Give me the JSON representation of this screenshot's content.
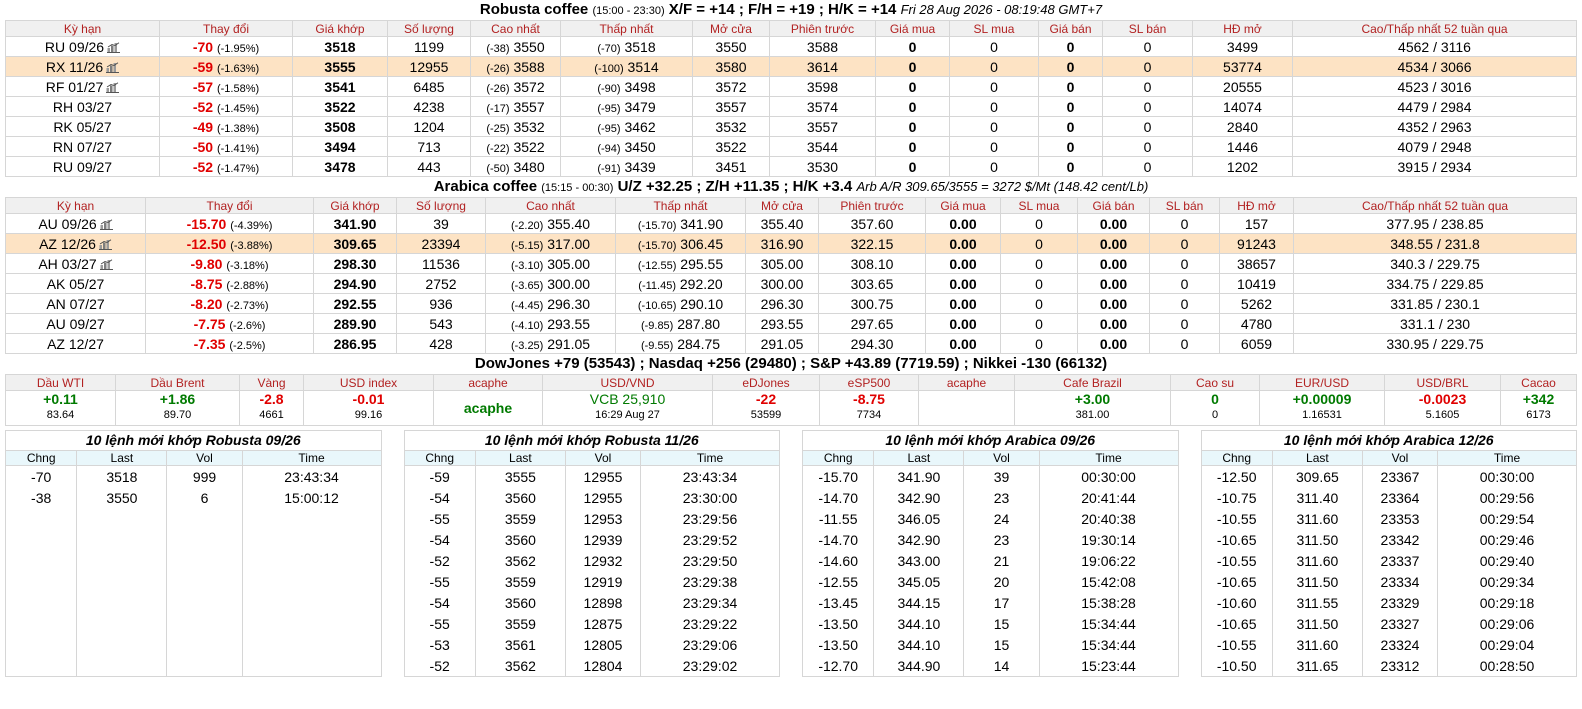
{
  "robusta": {
    "title_name": "Robusta coffee",
    "title_hours": "(15:00 - 23:30)",
    "title_spreads": "X/F = +14 ; F/H = +19 ; H/K = +14",
    "title_time": "Fri 28 Aug 2026 - 08:19:48 GMT+7",
    "headers": [
      "Kỳ hạn",
      "Thay đổi",
      "Giá khớp",
      "Số lượng",
      "Cao nhất",
      "Thấp nhất",
      "Mở cửa",
      "Phiên trước",
      "Giá mua",
      "SL mua",
      "Giá bán",
      "SL bán",
      "HĐ mở",
      "Cao/Thấp nhất 52 tuần qua"
    ],
    "rows": [
      {
        "term": "RU 09/26",
        "chart": true,
        "chg": "-70",
        "pct": "(-1.95%)",
        "match": "3518",
        "vol": "1199",
        "high_d": "(-38)",
        "high": "3550",
        "low_d": "(-70)",
        "low": "3518",
        "open": "3550",
        "prev": "3588",
        "bid": "0",
        "bid_vol": "0",
        "ask": "0",
        "ask_vol": "0",
        "oi": "3499",
        "range52": "4562 / 3116",
        "hl": false
      },
      {
        "term": "RX 11/26",
        "chart": true,
        "chg": "-59",
        "pct": "(-1.63%)",
        "match": "3555",
        "vol": "12955",
        "high_d": "(-26)",
        "high": "3588",
        "low_d": "(-100)",
        "low": "3514",
        "open": "3580",
        "prev": "3614",
        "bid": "0",
        "bid_vol": "0",
        "ask": "0",
        "ask_vol": "0",
        "oi": "53774",
        "range52": "4534 / 3066",
        "hl": true
      },
      {
        "term": "RF 01/27",
        "chart": true,
        "chg": "-57",
        "pct": "(-1.58%)",
        "match": "3541",
        "vol": "6485",
        "high_d": "(-26)",
        "high": "3572",
        "low_d": "(-90)",
        "low": "3498",
        "open": "3572",
        "prev": "3598",
        "bid": "0",
        "bid_vol": "0",
        "ask": "0",
        "ask_vol": "0",
        "oi": "20555",
        "range52": "4523 / 3016",
        "hl": false
      },
      {
        "term": "RH 03/27",
        "chart": false,
        "chg": "-52",
        "pct": "(-1.45%)",
        "match": "3522",
        "vol": "4238",
        "high_d": "(-17)",
        "high": "3557",
        "low_d": "(-95)",
        "low": "3479",
        "open": "3557",
        "prev": "3574",
        "bid": "0",
        "bid_vol": "0",
        "ask": "0",
        "ask_vol": "0",
        "oi": "14074",
        "range52": "4479 / 2984",
        "hl": false
      },
      {
        "term": "RK 05/27",
        "chart": false,
        "chg": "-49",
        "pct": "(-1.38%)",
        "match": "3508",
        "vol": "1204",
        "high_d": "(-25)",
        "high": "3532",
        "low_d": "(-95)",
        "low": "3462",
        "open": "3532",
        "prev": "3557",
        "bid": "0",
        "bid_vol": "0",
        "ask": "0",
        "ask_vol": "0",
        "oi": "2840",
        "range52": "4352 / 2963",
        "hl": false
      },
      {
        "term": "RN 07/27",
        "chart": false,
        "chg": "-50",
        "pct": "(-1.41%)",
        "match": "3494",
        "vol": "713",
        "high_d": "(-22)",
        "high": "3522",
        "low_d": "(-94)",
        "low": "3450",
        "open": "3522",
        "prev": "3544",
        "bid": "0",
        "bid_vol": "0",
        "ask": "0",
        "ask_vol": "0",
        "oi": "1446",
        "range52": "4079 / 2948",
        "hl": false
      },
      {
        "term": "RU 09/27",
        "chart": false,
        "chg": "-52",
        "pct": "(-1.47%)",
        "match": "3478",
        "vol": "443",
        "high_d": "(-50)",
        "high": "3480",
        "low_d": "(-91)",
        "low": "3439",
        "open": "3451",
        "prev": "3530",
        "bid": "0",
        "bid_vol": "0",
        "ask": "0",
        "ask_vol": "0",
        "oi": "1202",
        "range52": "3915 / 2934",
        "hl": false
      }
    ]
  },
  "arabica": {
    "title_name": "Arabica coffee",
    "title_hours": "(15:15 - 00:30)",
    "title_spreads": "U/Z +32.25 ; Z/H +11.35 ; H/K +3.4",
    "title_arb": "Arb A/R 309.65/3555 = 3272 $/Mt (148.42 cent/Lb)",
    "headers": [
      "Kỳ hạn",
      "Thay đổi",
      "Giá khớp",
      "Số lượng",
      "Cao nhất",
      "Thấp nhất",
      "Mở cửa",
      "Phiên trước",
      "Giá mua",
      "SL mua",
      "Giá bán",
      "SL bán",
      "HĐ mở",
      "Cao/Thấp nhất 52 tuần qua"
    ],
    "rows": [
      {
        "term": "AU 09/26",
        "chart": true,
        "chg": "-15.70",
        "pct": "(-4.39%)",
        "match": "341.90",
        "vol": "39",
        "high_d": "(-2.20)",
        "high": "355.40",
        "low_d": "(-15.70)",
        "low": "341.90",
        "open": "355.40",
        "prev": "357.60",
        "bid": "0.00",
        "bid_vol": "0",
        "ask": "0.00",
        "ask_vol": "0",
        "oi": "157",
        "range52": "377.95 / 238.85",
        "hl": false
      },
      {
        "term": "AZ 12/26",
        "chart": true,
        "chg": "-12.50",
        "pct": "(-3.88%)",
        "match": "309.65",
        "vol": "23394",
        "high_d": "(-5.15)",
        "high": "317.00",
        "low_d": "(-15.70)",
        "low": "306.45",
        "open": "316.90",
        "prev": "322.15",
        "bid": "0.00",
        "bid_vol": "0",
        "ask": "0.00",
        "ask_vol": "0",
        "oi": "91243",
        "range52": "348.55 / 231.8",
        "hl": true
      },
      {
        "term": "AH 03/27",
        "chart": true,
        "chg": "-9.80",
        "pct": "(-3.18%)",
        "match": "298.30",
        "vol": "11536",
        "high_d": "(-3.10)",
        "high": "305.00",
        "low_d": "(-12.55)",
        "low": "295.55",
        "open": "305.00",
        "prev": "308.10",
        "bid": "0.00",
        "bid_vol": "0",
        "ask": "0.00",
        "ask_vol": "0",
        "oi": "38657",
        "range52": "340.3 / 229.75",
        "hl": false
      },
      {
        "term": "AK 05/27",
        "chart": false,
        "chg": "-8.75",
        "pct": "(-2.88%)",
        "match": "294.90",
        "vol": "2752",
        "high_d": "(-3.65)",
        "high": "300.00",
        "low_d": "(-11.45)",
        "low": "292.20",
        "open": "300.00",
        "prev": "303.65",
        "bid": "0.00",
        "bid_vol": "0",
        "ask": "0.00",
        "ask_vol": "0",
        "oi": "10419",
        "range52": "334.75 / 229.85",
        "hl": false
      },
      {
        "term": "AN 07/27",
        "chart": false,
        "chg": "-8.20",
        "pct": "(-2.73%)",
        "match": "292.55",
        "vol": "936",
        "high_d": "(-4.45)",
        "high": "296.30",
        "low_d": "(-10.65)",
        "low": "290.10",
        "open": "296.30",
        "prev": "300.75",
        "bid": "0.00",
        "bid_vol": "0",
        "ask": "0.00",
        "ask_vol": "0",
        "oi": "5262",
        "range52": "331.85 / 230.1",
        "hl": false
      },
      {
        "term": "AU 09/27",
        "chart": false,
        "chg": "-7.75",
        "pct": "(-2.6%)",
        "match": "289.90",
        "vol": "543",
        "high_d": "(-4.10)",
        "high": "293.55",
        "low_d": "(-9.85)",
        "low": "287.80",
        "open": "293.55",
        "prev": "297.65",
        "bid": "0.00",
        "bid_vol": "0",
        "ask": "0.00",
        "ask_vol": "0",
        "oi": "4780",
        "range52": "331.1 / 230",
        "hl": false
      },
      {
        "term": "AZ 12/27",
        "chart": false,
        "chg": "-7.35",
        "pct": "(-2.5%)",
        "match": "286.95",
        "vol": "428",
        "high_d": "(-3.25)",
        "high": "291.05",
        "low_d": "(-9.55)",
        "low": "284.75",
        "open": "291.05",
        "prev": "294.30",
        "bid": "0.00",
        "bid_vol": "0",
        "ask": "0.00",
        "ask_vol": "0",
        "oi": "6059",
        "range52": "330.95 / 229.75",
        "hl": false
      }
    ]
  },
  "indices_title": "DowJones +79 (53543) ; Nasdaq +256 (29480) ; S&P +43.89 (7719.59) ; Nikkei -130 (66132)",
  "indices": [
    {
      "label": "Dầu WTI",
      "value": "+0.11",
      "color": "green",
      "sub": "83.64"
    },
    {
      "label": "Dầu Brent",
      "value": "+1.86",
      "color": "green",
      "sub": "89.70"
    },
    {
      "label": "Vàng",
      "value": "-2.8",
      "color": "red",
      "sub": "4661"
    },
    {
      "label": "USD index",
      "value": "-0.01",
      "color": "red",
      "sub": "99.16"
    },
    {
      "label": "acaphe",
      "value": "acaphe",
      "color": "green",
      "sub": "",
      "center": true
    },
    {
      "label": "USD/VND",
      "value": "VCB 25,910",
      "color": "green",
      "sub": "16:29 Aug 27",
      "normal": true
    },
    {
      "label": "eDJones",
      "value": "-22",
      "color": "red",
      "sub": "53599"
    },
    {
      "label": "eSP500",
      "value": "-8.75",
      "color": "red",
      "sub": "7734"
    },
    {
      "label": "acaphe",
      "value": "",
      "color": "green",
      "sub": ""
    },
    {
      "label": "Cafe Brazil",
      "value": "+3.00",
      "color": "green",
      "sub": "381.00"
    },
    {
      "label": "Cao su",
      "value": "0",
      "color": "green",
      "sub": "0"
    },
    {
      "label": "EUR/USD",
      "value": "+0.00009",
      "color": "green",
      "sub": "1.16531"
    },
    {
      "label": "USD/BRL",
      "value": "-0.0023",
      "color": "red",
      "sub": "5.1605"
    },
    {
      "label": "Cacao",
      "value": "+342",
      "color": "green",
      "sub": "6173"
    }
  ],
  "trades": [
    {
      "title": "10 lệnh mới khớp Robusta 09/26",
      "headers": [
        "Chng",
        "Last",
        "Vol",
        "Time"
      ],
      "rows": [
        [
          "-70",
          "3518",
          "999",
          "23:43:34"
        ],
        [
          "-38",
          "3550",
          "6",
          "15:00:12"
        ],
        [
          "",
          "",
          "",
          ""
        ],
        [
          "",
          "",
          "",
          ""
        ],
        [
          "",
          "",
          "",
          ""
        ],
        [
          "",
          "",
          "",
          ""
        ],
        [
          "",
          "",
          "",
          ""
        ],
        [
          "",
          "",
          "",
          ""
        ],
        [
          "",
          "",
          "",
          ""
        ],
        [
          "",
          "",
          "",
          ""
        ]
      ]
    },
    {
      "title": "10 lệnh mới khớp Robusta 11/26",
      "headers": [
        "Chng",
        "Last",
        "Vol",
        "Time"
      ],
      "rows": [
        [
          "-59",
          "3555",
          "12955",
          "23:43:34"
        ],
        [
          "-54",
          "3560",
          "12955",
          "23:30:00"
        ],
        [
          "-55",
          "3559",
          "12953",
          "23:29:56"
        ],
        [
          "-54",
          "3560",
          "12939",
          "23:29:52"
        ],
        [
          "-52",
          "3562",
          "12932",
          "23:29:50"
        ],
        [
          "-55",
          "3559",
          "12919",
          "23:29:38"
        ],
        [
          "-54",
          "3560",
          "12898",
          "23:29:34"
        ],
        [
          "-55",
          "3559",
          "12875",
          "23:29:22"
        ],
        [
          "-53",
          "3561",
          "12805",
          "23:29:06"
        ],
        [
          "-52",
          "3562",
          "12804",
          "23:29:02"
        ]
      ]
    },
    {
      "title": "10 lệnh mới khớp Arabica 09/26",
      "headers": [
        "Chng",
        "Last",
        "Vol",
        "Time"
      ],
      "rows": [
        [
          "-15.70",
          "341.90",
          "39",
          "00:30:00"
        ],
        [
          "-14.70",
          "342.90",
          "23",
          "20:41:44"
        ],
        [
          "-11.55",
          "346.05",
          "24",
          "20:40:38"
        ],
        [
          "-14.70",
          "342.90",
          "23",
          "19:30:14"
        ],
        [
          "-14.60",
          "343.00",
          "21",
          "19:06:22"
        ],
        [
          "-12.55",
          "345.05",
          "20",
          "15:42:08"
        ],
        [
          "-13.45",
          "344.15",
          "17",
          "15:38:28"
        ],
        [
          "-13.50",
          "344.10",
          "15",
          "15:34:44"
        ],
        [
          "-13.50",
          "344.10",
          "15",
          "15:34:44"
        ],
        [
          "-12.70",
          "344.90",
          "14",
          "15:23:44"
        ]
      ]
    },
    {
      "title": "10 lệnh mới khớp Arabica 12/26",
      "headers": [
        "Chng",
        "Last",
        "Vol",
        "Time"
      ],
      "rows": [
        [
          "-12.50",
          "309.65",
          "23367",
          "00:30:00"
        ],
        [
          "-10.75",
          "311.40",
          "23364",
          "00:29:56"
        ],
        [
          "-10.55",
          "311.60",
          "23353",
          "00:29:54"
        ],
        [
          "-10.65",
          "311.50",
          "23342",
          "00:29:46"
        ],
        [
          "-10.55",
          "311.60",
          "23337",
          "00:29:40"
        ],
        [
          "-10.65",
          "311.50",
          "23334",
          "00:29:34"
        ],
        [
          "-10.60",
          "311.55",
          "23329",
          "00:29:18"
        ],
        [
          "-10.65",
          "311.50",
          "23327",
          "00:29:06"
        ],
        [
          "-10.55",
          "311.60",
          "23324",
          "00:29:04"
        ],
        [
          "-10.50",
          "311.65",
          "23312",
          "00:28:50"
        ]
      ]
    }
  ]
}
